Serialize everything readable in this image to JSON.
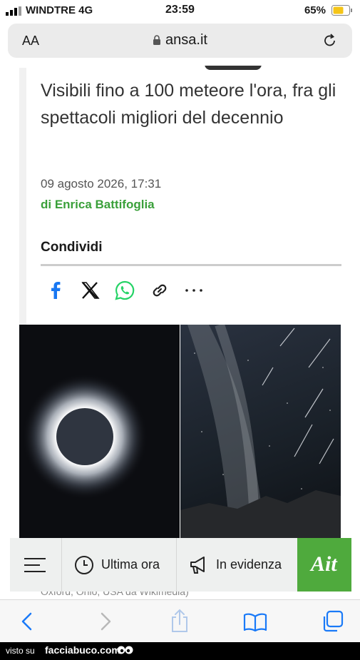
{
  "status": {
    "carrier": "WINDTRE 4G",
    "time": "23:59",
    "battery": "65%"
  },
  "browser": {
    "text_size_label": "AA",
    "host": "ansa.it"
  },
  "article": {
    "title": "Visibili fino a 100 meteore l'ora, fra gli spettacoli migliori del decennio",
    "date": "09 agosto 2026, 17:31",
    "author": "di Enrica Battifoglia",
    "share_label": "Condividi"
  },
  "image_caption": "Oxford, Ohio, USA da Wikimedia)",
  "ansa_bar": {
    "recent_label": "Ultima ora",
    "featured_label": "In evidenza",
    "brand": "Ait"
  },
  "footer": {
    "left": "visto su",
    "site": "facciabuco.com"
  },
  "colors": {
    "accent_green": "#4faa3d",
    "author_green": "#3aa03a",
    "facebook_blue": "#1877f2",
    "whatsapp_green": "#25d366"
  }
}
